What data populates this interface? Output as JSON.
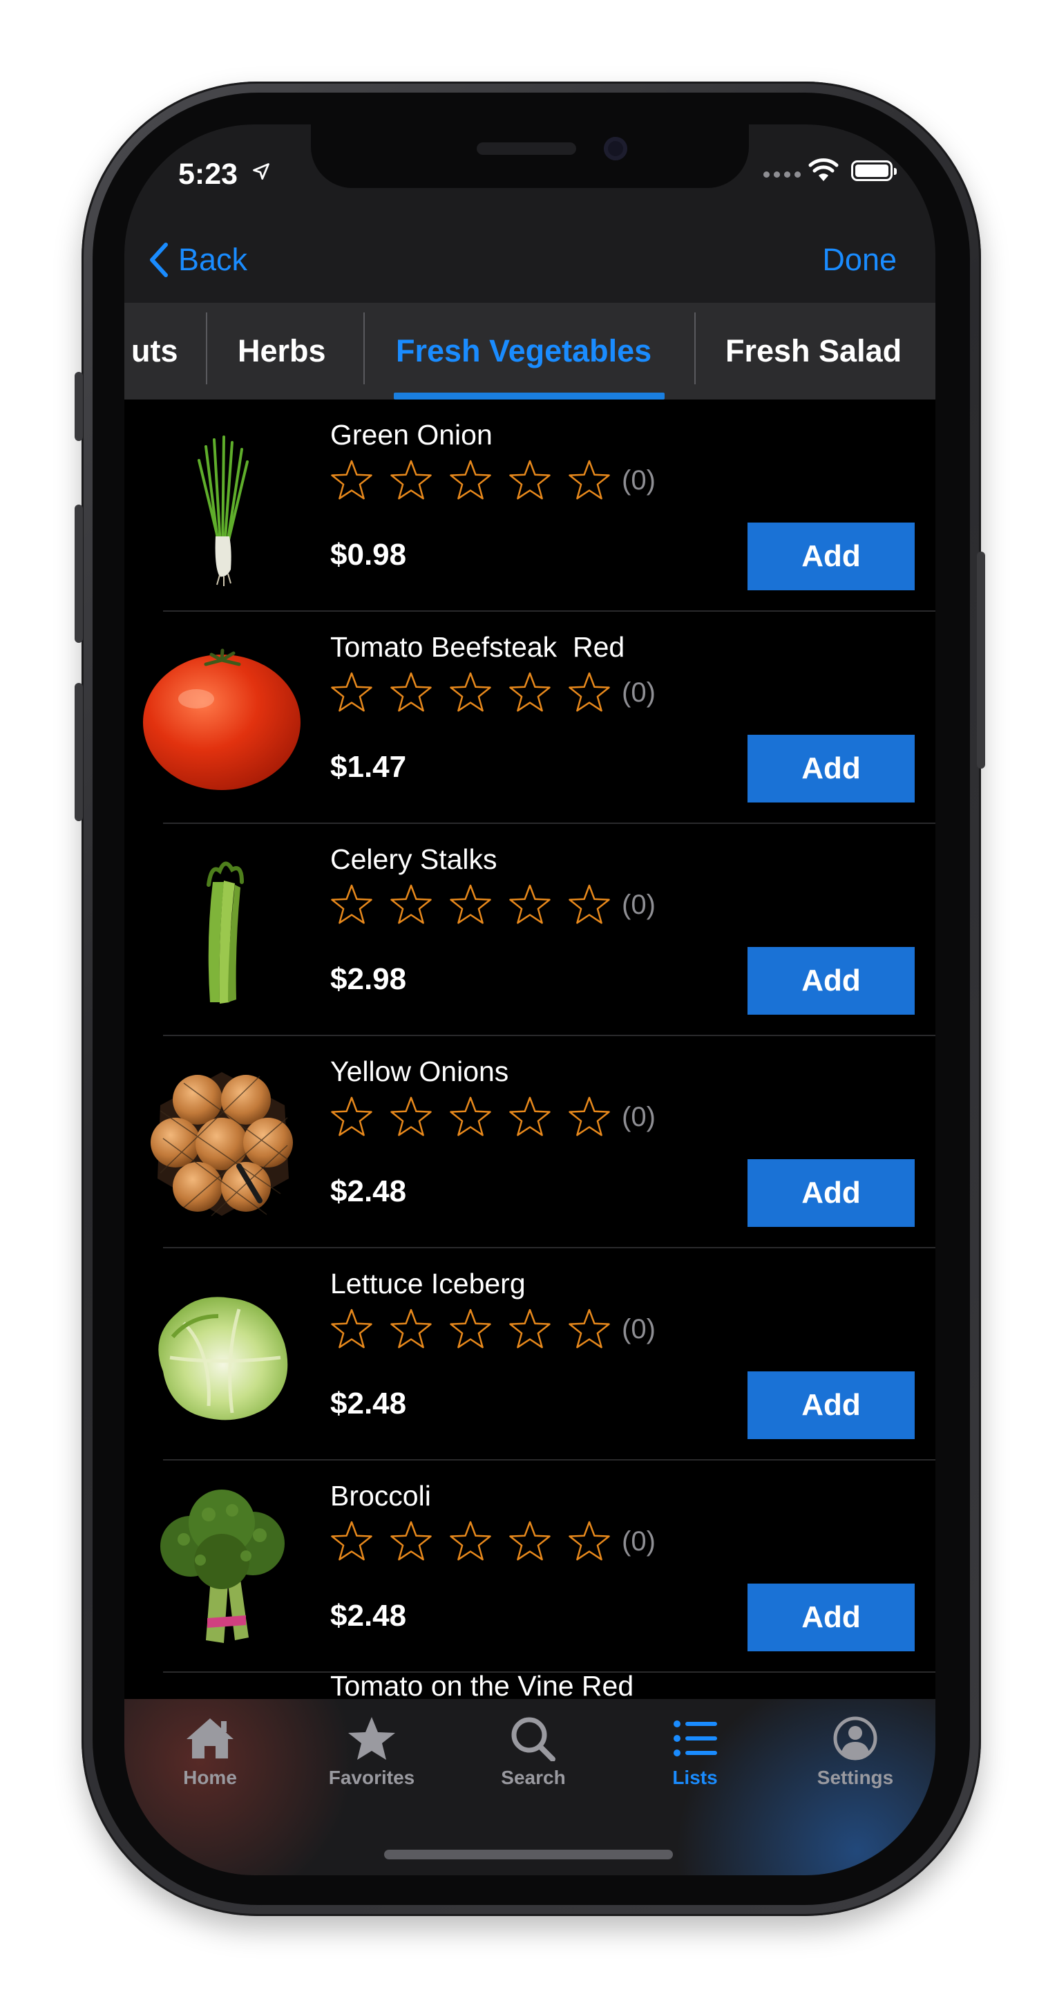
{
  "status_bar": {
    "time": "5:23"
  },
  "nav": {
    "back_label": "Back",
    "done_label": "Done"
  },
  "tabs": [
    {
      "label": "uts"
    },
    {
      "label": "Herbs"
    },
    {
      "label": "Fresh Vegetables",
      "active": true
    },
    {
      "label": "Fresh Salad"
    }
  ],
  "products": [
    {
      "name": "Green Onion",
      "rating_count": "(0)",
      "price": "$0.98",
      "add_label": "Add",
      "image": "green-onion-image"
    },
    {
      "name": "Tomato Beefsteak  Red",
      "rating_count": "(0)",
      "price": "$1.47",
      "add_label": "Add",
      "image": "tomato-image"
    },
    {
      "name": "Celery Stalks",
      "rating_count": "(0)",
      "price": "$2.98",
      "add_label": "Add",
      "image": "celery-image"
    },
    {
      "name": "Yellow Onions",
      "rating_count": "(0)",
      "price": "$2.48",
      "add_label": "Add",
      "image": "yellow-onions-image"
    },
    {
      "name": "Lettuce Iceberg",
      "rating_count": "(0)",
      "price": "$2.48",
      "add_label": "Add",
      "image": "lettuce-image"
    },
    {
      "name": "Broccoli",
      "rating_count": "(0)",
      "price": "$2.48",
      "add_label": "Add",
      "image": "broccoli-image"
    }
  ],
  "partial_product": {
    "name": "Tomato on the Vine Red"
  },
  "rating": {
    "stars": 0,
    "max_stars": 5
  },
  "tab_bar": {
    "items": [
      {
        "label": "Home",
        "icon": "house-icon"
      },
      {
        "label": "Favorites",
        "icon": "star-icon"
      },
      {
        "label": "Search",
        "icon": "magnifier-icon"
      },
      {
        "label": "Lists",
        "icon": "list-icon",
        "active": true
      },
      {
        "label": "Settings",
        "icon": "person-circle-icon"
      }
    ]
  },
  "colors": {
    "accent": "#1a8cff",
    "add_button": "#1a72d6",
    "star_outline": "#e8891c",
    "background": "#000000"
  }
}
